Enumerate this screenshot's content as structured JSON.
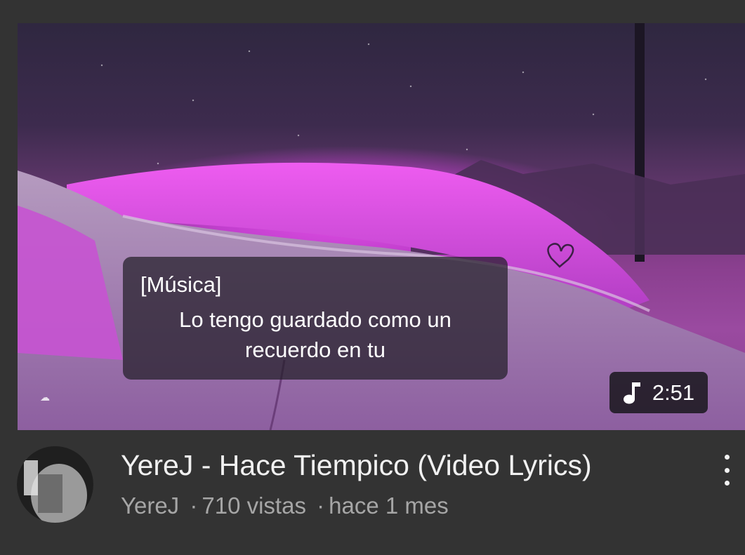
{
  "video": {
    "captions": {
      "tag": "[Música]",
      "line1": "Lo tengo guardado como un",
      "line2": "recuerdo en tu"
    },
    "duration": "2:51",
    "duration_icon": "music-note-icon",
    "title": "YereJ - Hace Tiempico (Video Lyrics)",
    "channel": "YereJ",
    "views": "710 vistas",
    "age": "hace 1 mes",
    "meta_separator": "·",
    "menu_icon": "more-vertical-icon"
  },
  "colors": {
    "background": "#333333",
    "title": "#f1f1f1",
    "meta": "#a6a6a6",
    "thumb_accent": "#e14fe6"
  }
}
